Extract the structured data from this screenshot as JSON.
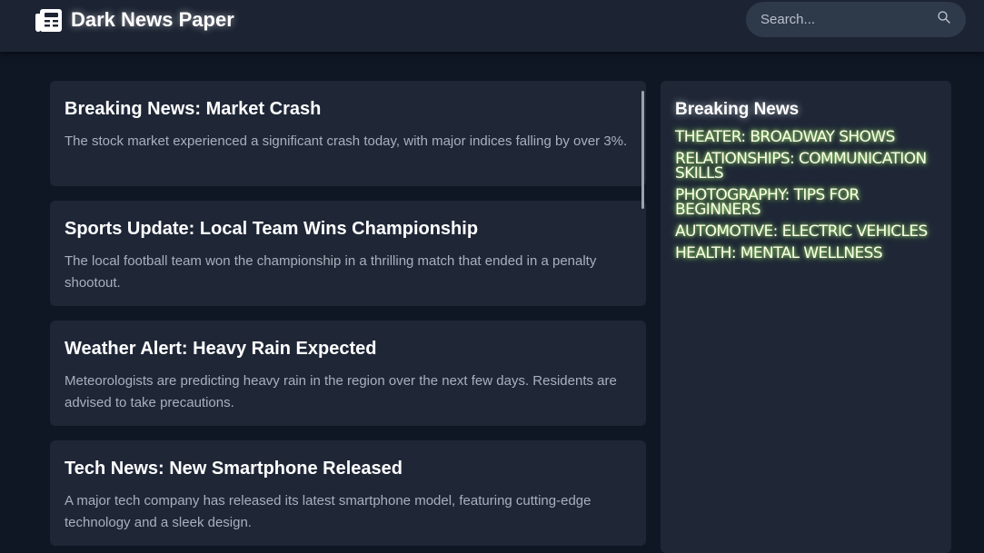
{
  "header": {
    "title": "Dark News Paper",
    "logo_icon": "newspaper-icon",
    "search_placeholder": "Search...",
    "search_icon": "search-icon"
  },
  "articles": [
    {
      "title": "Breaking News: Market Crash",
      "body": "The stock market experienced a significant crash today, with major indices falling by over 3%."
    },
    {
      "title": "Sports Update: Local Team Wins Championship",
      "body": "The local football team won the championship in a thrilling match that ended in a penalty shootout."
    },
    {
      "title": "Weather Alert: Heavy Rain Expected",
      "body": "Meteorologists are predicting heavy rain in the region over the next few days. Residents are advised to take precautions."
    },
    {
      "title": "Tech News: New Smartphone Released",
      "body": "A major tech company has released its latest smartphone model, featuring cutting-edge technology and a sleek design."
    }
  ],
  "sidebar": {
    "title": "Breaking News",
    "items": [
      "Theater: Broadway Shows",
      "Relationships: Communication Skills",
      "Photography: Tips for Beginners",
      "Automotive: Electric Vehicles",
      "Health: Mental Wellness"
    ]
  },
  "colors": {
    "page_background": "#0f1624",
    "header_background": "#1c2433",
    "card_background": "#1f2737",
    "headline_glow": "#b4ff78"
  }
}
